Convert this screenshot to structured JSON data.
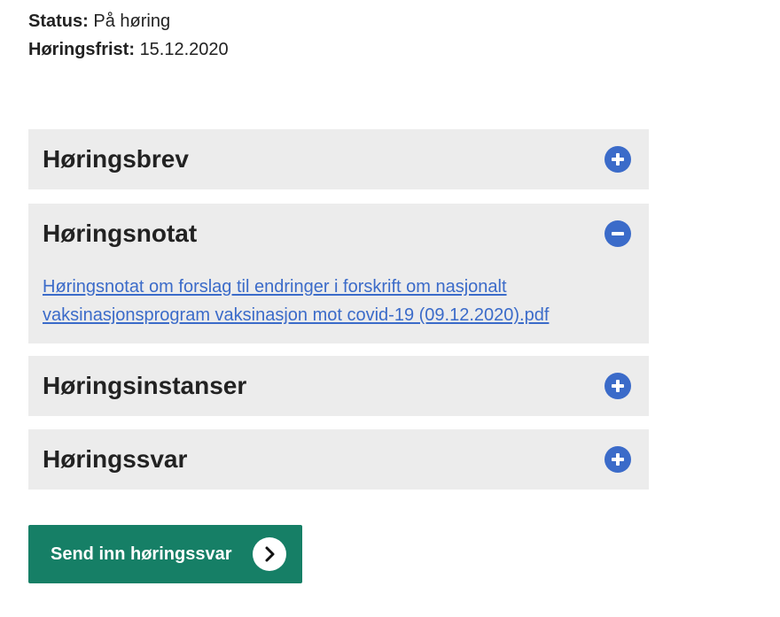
{
  "meta": {
    "status_label": "Status:",
    "status_value": "På høring",
    "deadline_label": "Høringsfrist:",
    "deadline_value": "15.12.2020"
  },
  "accordions": [
    {
      "title": "Høringsbrev",
      "state": "collapsed",
      "icon": "plus-circle-icon"
    },
    {
      "title": "Høringsnotat",
      "state": "expanded",
      "icon": "minus-circle-icon",
      "link_line_1": "Høringsnotat om forslag til endringer i forskrift om nasjonalt",
      "link_line_2": "vaksinasjonsprogram vaksinasjon mot covid-19 (09.12.2020).pdf"
    },
    {
      "title": "Høringsinstanser",
      "state": "collapsed",
      "icon": "plus-circle-icon"
    },
    {
      "title": "Høringssvar",
      "state": "collapsed",
      "icon": "plus-circle-icon"
    }
  ],
  "submit_button": {
    "label": "Send inn høringssvar",
    "icon": "chevron-right-icon"
  },
  "colors": {
    "accent_blue": "#3b6bc9",
    "panel_gray": "#ececec",
    "button_green": "#167f66"
  }
}
